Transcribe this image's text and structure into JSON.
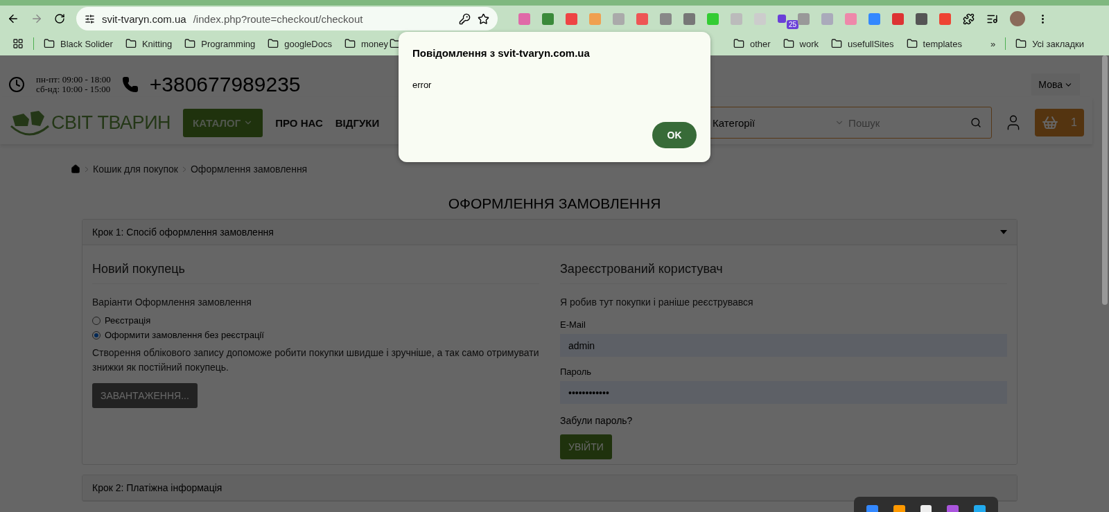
{
  "browser": {
    "url_host": "svit-tvaryn.com.ua",
    "url_path": "/index.php?route=checkout/checkout",
    "extension_badge": "25",
    "bookmarks": [
      "Black Solider",
      "Knitting",
      "Programming",
      "googleDocs",
      "money",
      "other",
      "work",
      "usefullSites",
      "templates"
    ],
    "more": "»",
    "all_bookmarks": "Усі закладки"
  },
  "header": {
    "hours": [
      "пн-пт: 09:00 - 18:00",
      "сб-нд: 10:00 - 15:00"
    ],
    "phone": "+380677989235",
    "language": "Мова",
    "logo": "СВІТ ТВАРИН",
    "nav": [
      {
        "label": "КАТАЛОГ",
        "kind": "dropdown"
      },
      {
        "label": "ПРО НАС",
        "kind": "link"
      },
      {
        "label": "ВІДГУКИ",
        "kind": "link"
      }
    ],
    "search": {
      "category": "Категорії",
      "placeholder": "Пошук"
    },
    "cart_count": "1"
  },
  "breadcrumbs": [
    "Кошик для покупок",
    "Оформлення замовлення"
  ],
  "title": "ОФОРМЛЕННЯ ЗАМОВЛЕННЯ",
  "steps": [
    {
      "title": "Крок 1: Спосіб оформлення замовлення",
      "expanded": true
    },
    {
      "title": "Крок 2: Платіжна інформація",
      "expanded": false
    }
  ],
  "new_customer": {
    "heading": "Новий покупець",
    "subheading": "Варіанти Оформлення замовлення",
    "options": [
      {
        "label": "Реєстрація",
        "selected": false
      },
      {
        "label": "Оформити замовлення без реєстрації",
        "selected": true
      }
    ],
    "text": "Створення облікового запису допоможе робити покупки швидше і зручніше, а так само отримувати знижки як постійний покупець.",
    "button": "ЗАВАНТАЖЕННЯ..."
  },
  "registered": {
    "heading": "Зареєстрований користувач",
    "text": "Я робив тут покупки і раніше реєструвався",
    "email_label": "E-Mail",
    "email_value": "admin",
    "password_label": "Пароль",
    "password_value": "••••••••••••",
    "forgot": "Забули пароль?",
    "button": "УВІЙТИ"
  },
  "dialog": {
    "title": "Повідомлення з svit-tvaryn.com.ua",
    "message": "error",
    "button": "OK"
  }
}
